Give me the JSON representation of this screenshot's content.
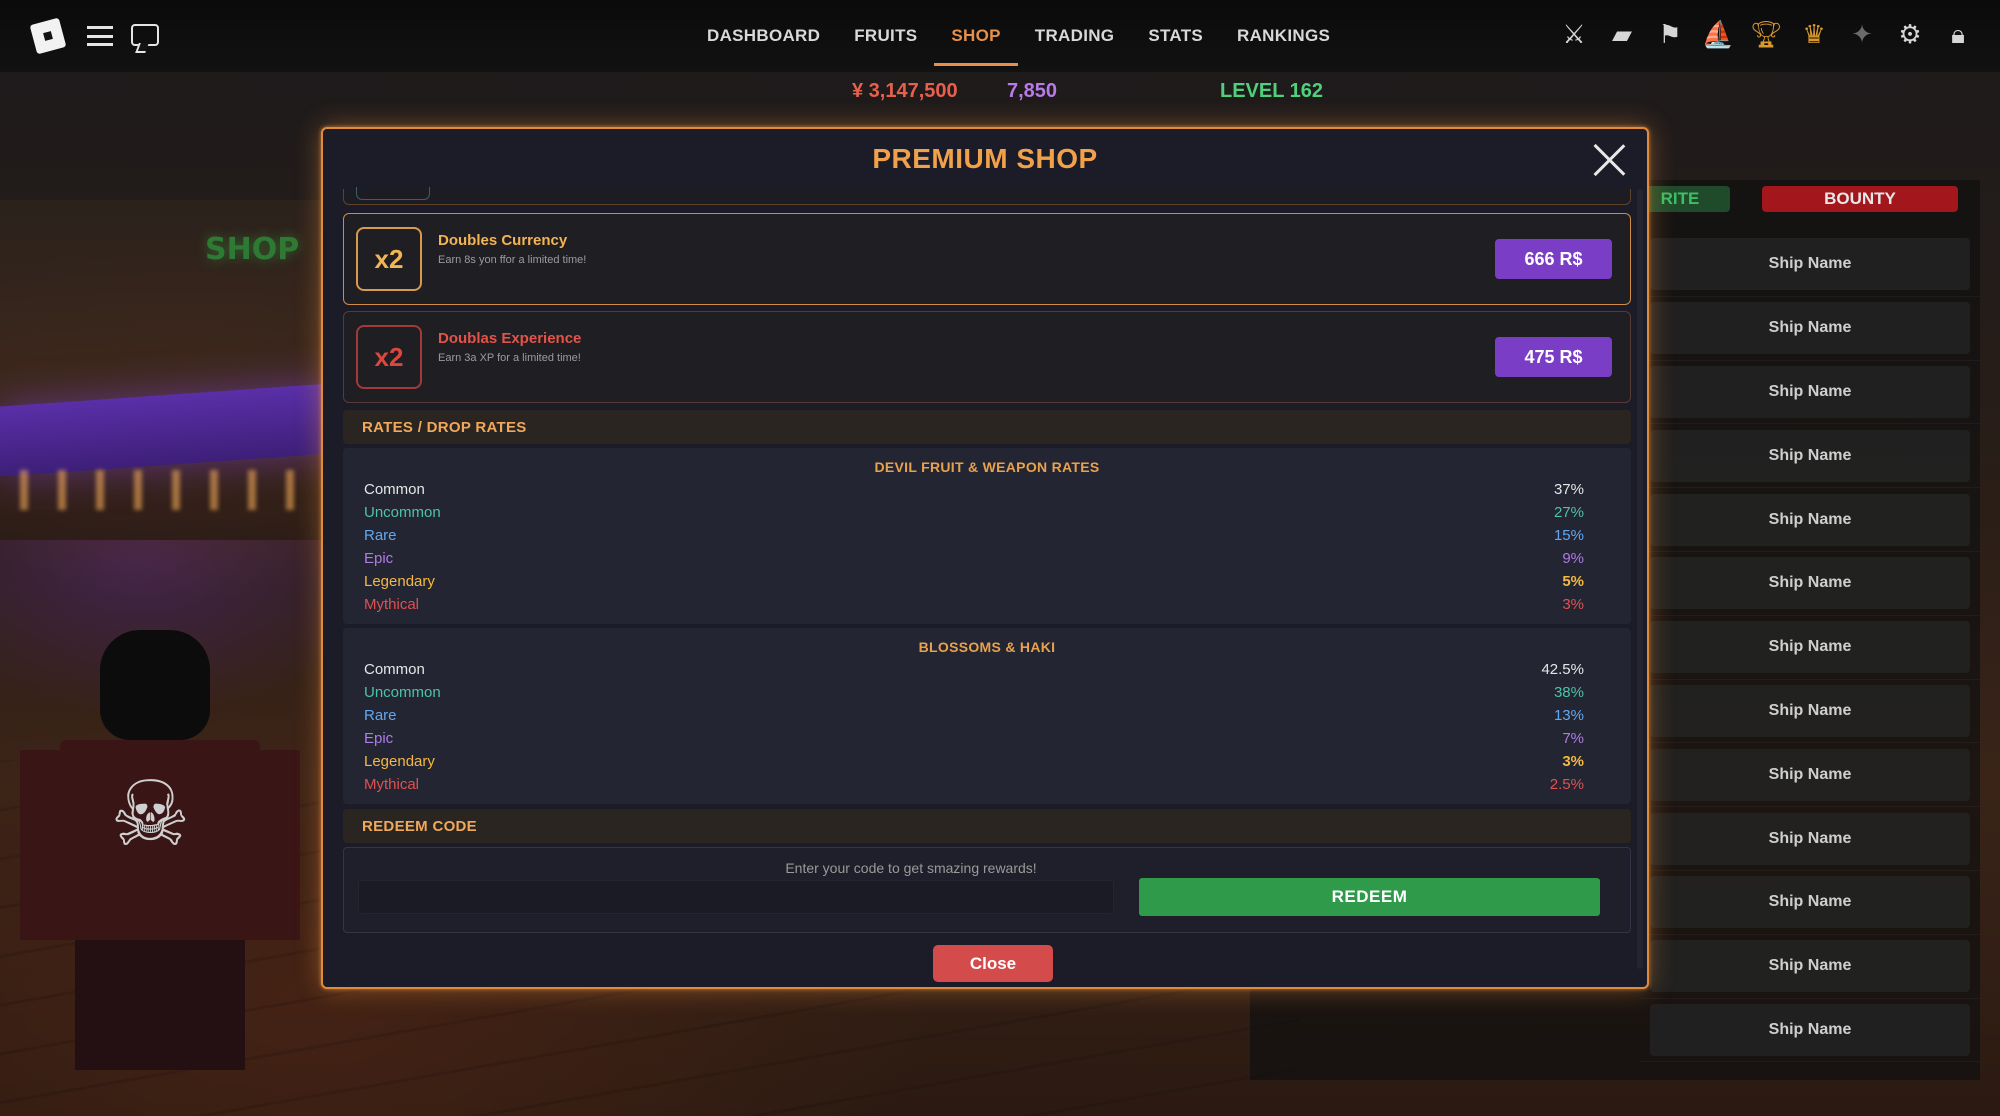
{
  "nav": {
    "items": [
      {
        "label": "DASHBOARD",
        "active": false
      },
      {
        "label": "FRUITS",
        "active": false
      },
      {
        "label": "SHOP",
        "active": true
      },
      {
        "label": "TRADING",
        "active": false
      },
      {
        "label": "STATS",
        "active": false
      },
      {
        "label": "RANKINGS",
        "active": false
      }
    ],
    "left_icons": [
      "roblox-logo-icon",
      "menu-icon",
      "chat-icon"
    ],
    "right_icons": [
      "crossed-swords-icon",
      "folder-icon",
      "flag-icon",
      "ship-icon",
      "trophy-icon",
      "trophy-gold-icon",
      "locked-badge-icon",
      "settings-gear-icon",
      "backpack-icon"
    ]
  },
  "currency": {
    "beli": "¥ 3,147,500",
    "gems": "7,850",
    "level": "LEVEL 162"
  },
  "background": {
    "sign_text": "SHOP",
    "tab_partial": "RITE",
    "tab_bounty": "BOUNTY",
    "rows": [
      "Ship Name",
      "Ship Name",
      "Ship Name",
      "Ship Name",
      "Ship Name",
      "Ship Name",
      "Ship Name",
      "Ship Name",
      "Ship Name",
      "Ship Name",
      "Ship Name",
      "Ship Name",
      "Ship Name"
    ]
  },
  "modal": {
    "title": "PREMIUM SHOP",
    "offers": [
      {
        "badge": "x2",
        "name": "Doubles Currency",
        "desc": "Earn 8s yon ffor a limited time!",
        "price": "666 R$"
      },
      {
        "badge": "x2",
        "name": "Doublas Experience",
        "desc": "Earn 3a XP for a limited time!",
        "price": "475 R$"
      }
    ],
    "rates_header": "RATES / DROP RATES",
    "rate_tables": [
      {
        "title": "DEVIL FRUIT & WEAPON RATES",
        "rows": [
          {
            "name": "Common",
            "value": "37%"
          },
          {
            "name": "Uncommon",
            "value": "27%"
          },
          {
            "name": "Rare",
            "value": "15%"
          },
          {
            "name": "Epic",
            "value": "9%"
          },
          {
            "name": "Legendary",
            "value": "5%"
          },
          {
            "name": "Mythical",
            "value": "3%"
          }
        ]
      },
      {
        "title": "BLOSSOMS & HAKI",
        "rows": [
          {
            "name": "Common",
            "value": "42.5%"
          },
          {
            "name": "Uncommon",
            "value": "38%"
          },
          {
            "name": "Rare",
            "value": "13%"
          },
          {
            "name": "Epic",
            "value": "7%"
          },
          {
            "name": "Legendary",
            "value": "3%"
          },
          {
            "name": "Mythical",
            "value": "2.5%"
          }
        ]
      }
    ],
    "redeem_header": "REDEEM CODE",
    "redeem_hint": "Enter your code to get smazing rewards!",
    "redeem_input_value": "",
    "redeem_button": "REDEEM",
    "close_button": "Close"
  },
  "colors": {
    "accent_orange": "#e08a3c",
    "purchase_purple": "#7a3ec6",
    "redeem_green": "#2f9a4a",
    "close_red": "#d34b4b",
    "rarity": {
      "Common": "#e6e6e6",
      "Uncommon": "#4cc2a8",
      "Rare": "#62a8f0",
      "Epic": "#b07ae8",
      "Legendary": "#f5b840",
      "Mythical": "#e15050"
    }
  }
}
